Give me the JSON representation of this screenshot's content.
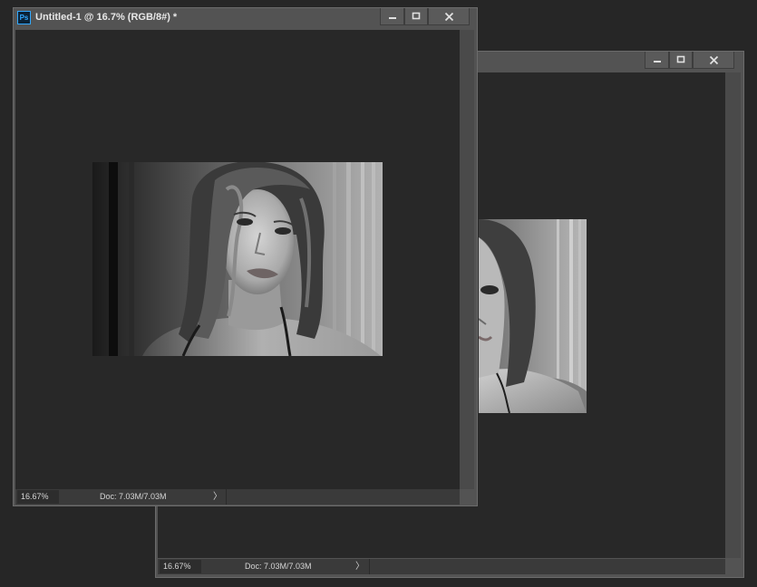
{
  "back_window": {
    "zoom": "16.67%",
    "doc_info": "Doc: 7.03M/7.03M",
    "status_arrow": "〉"
  },
  "front_window": {
    "app_icon_label": "Ps",
    "title": "Untitled-1 @ 16.7% (RGB/8#) *",
    "zoom": "16.67%",
    "doc_info": "Doc: 7.03M/7.03M",
    "status_arrow": "〉"
  },
  "icons": {
    "app": "photoshop-icon",
    "minimize": "minimize-icon",
    "maximize": "maximize-icon",
    "close": "close-icon"
  },
  "colors": {
    "workspace": "#262626",
    "panel": "#535353",
    "canvas_bg": "#282828",
    "ps_accent": "#31a8ff"
  }
}
